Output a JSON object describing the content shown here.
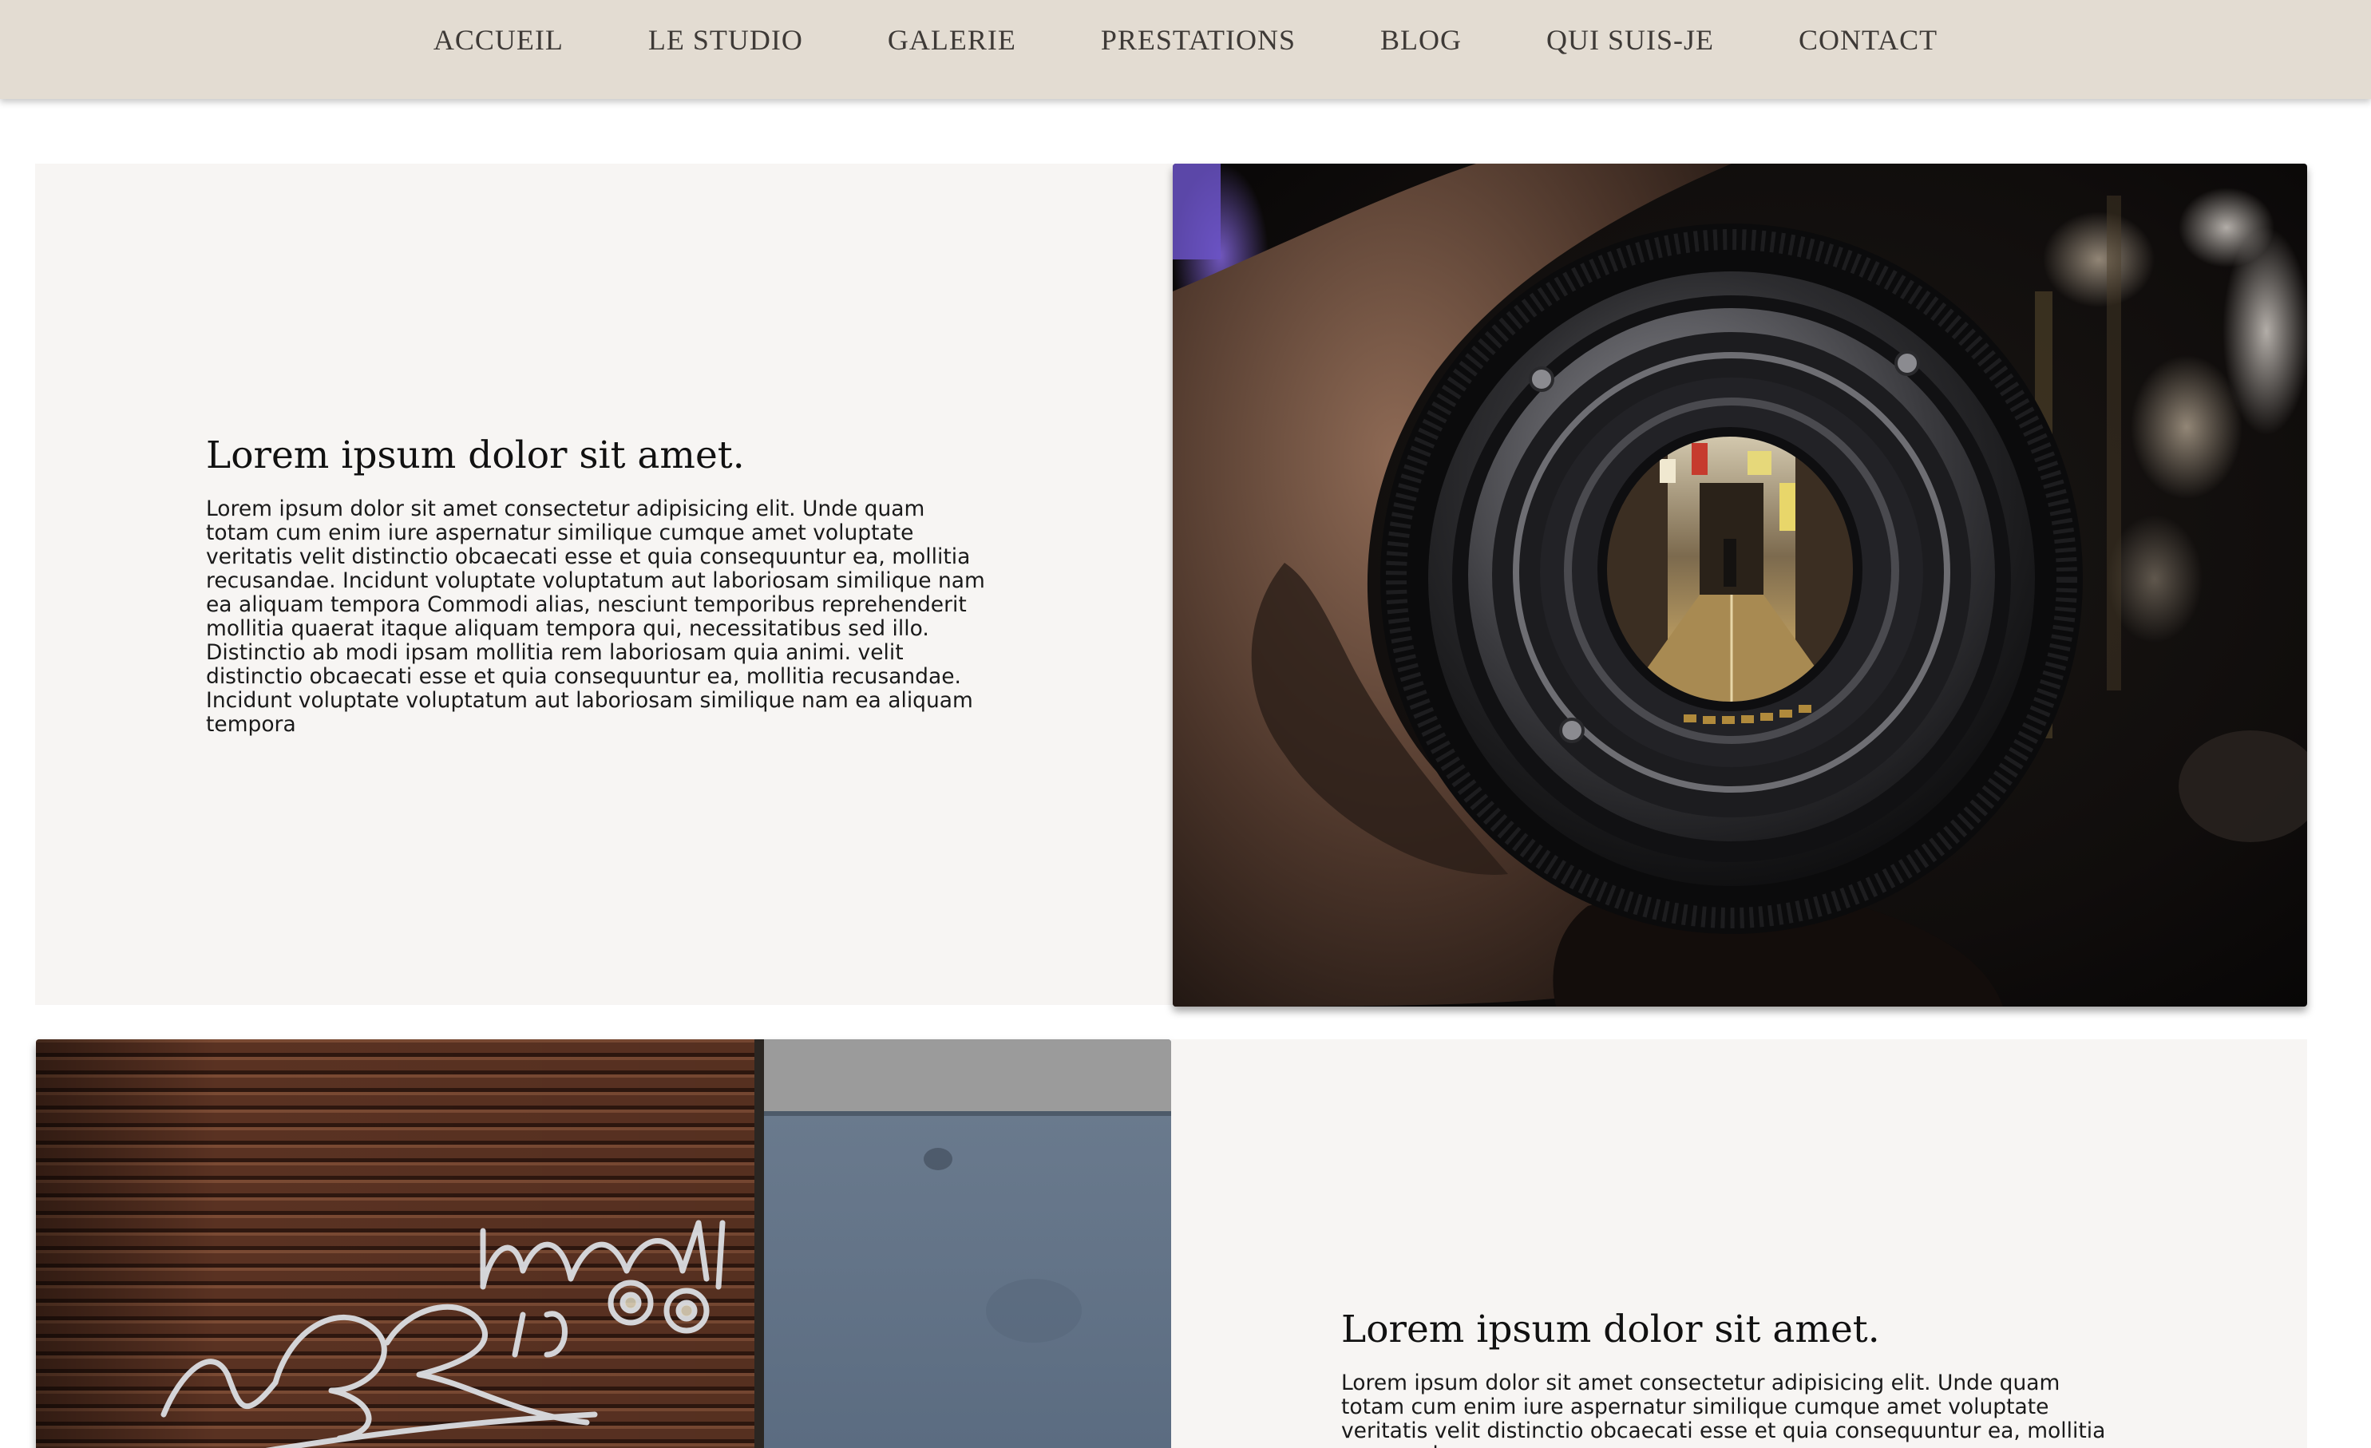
{
  "nav": {
    "items": [
      {
        "label": "ACCUEIL"
      },
      {
        "label": "LE STUDIO"
      },
      {
        "label": "GALERIE"
      },
      {
        "label": "PRESTATIONS"
      },
      {
        "label": "BLOG"
      },
      {
        "label": "QUI SUIS-JE"
      },
      {
        "label": "CONTACT"
      }
    ]
  },
  "sections": [
    {
      "heading": "Lorem ipsum dolor sit amet.",
      "body": "Lorem ipsum dolor sit amet consectetur adipisicing elit. Unde quam totam cum enim iure aspernatur similique cumque amet voluptate veritatis velit distinctio obcaecati esse et quia consequuntur ea, mollitia recusandae. Incidunt voluptate voluptatum aut laboriosam similique nam ea aliquam tempora Commodi alias, nesciunt temporibus reprehenderit mollitia quaerat itaque aliquam tempora qui, necessitatibus sed illo. Distinctio ab modi ipsam mollitia rem laboriosam quia animi. velit distinctio obcaecati esse et quia consequuntur ea, mollitia recusandae. Incidunt voluptate voluptatum aut laboriosam similique nam ea aliquam tempora",
      "image": "camera-lens-photo"
    },
    {
      "heading": "Lorem ipsum dolor sit amet.",
      "body": "Lorem ipsum dolor sit amet consectetur adipisicing elit. Unde quam totam cum enim iure aspernatur similique cumque amet voluptate veritatis velit distinctio obcaecati esse et quia consequuntur ea, mollitia recusandae.",
      "image": "graffiti-shutter-photo"
    }
  ],
  "colors": {
    "nav_background": "#e3dcd2",
    "nav_text": "#3e3a37",
    "panel_background": "#f7f5f3"
  }
}
